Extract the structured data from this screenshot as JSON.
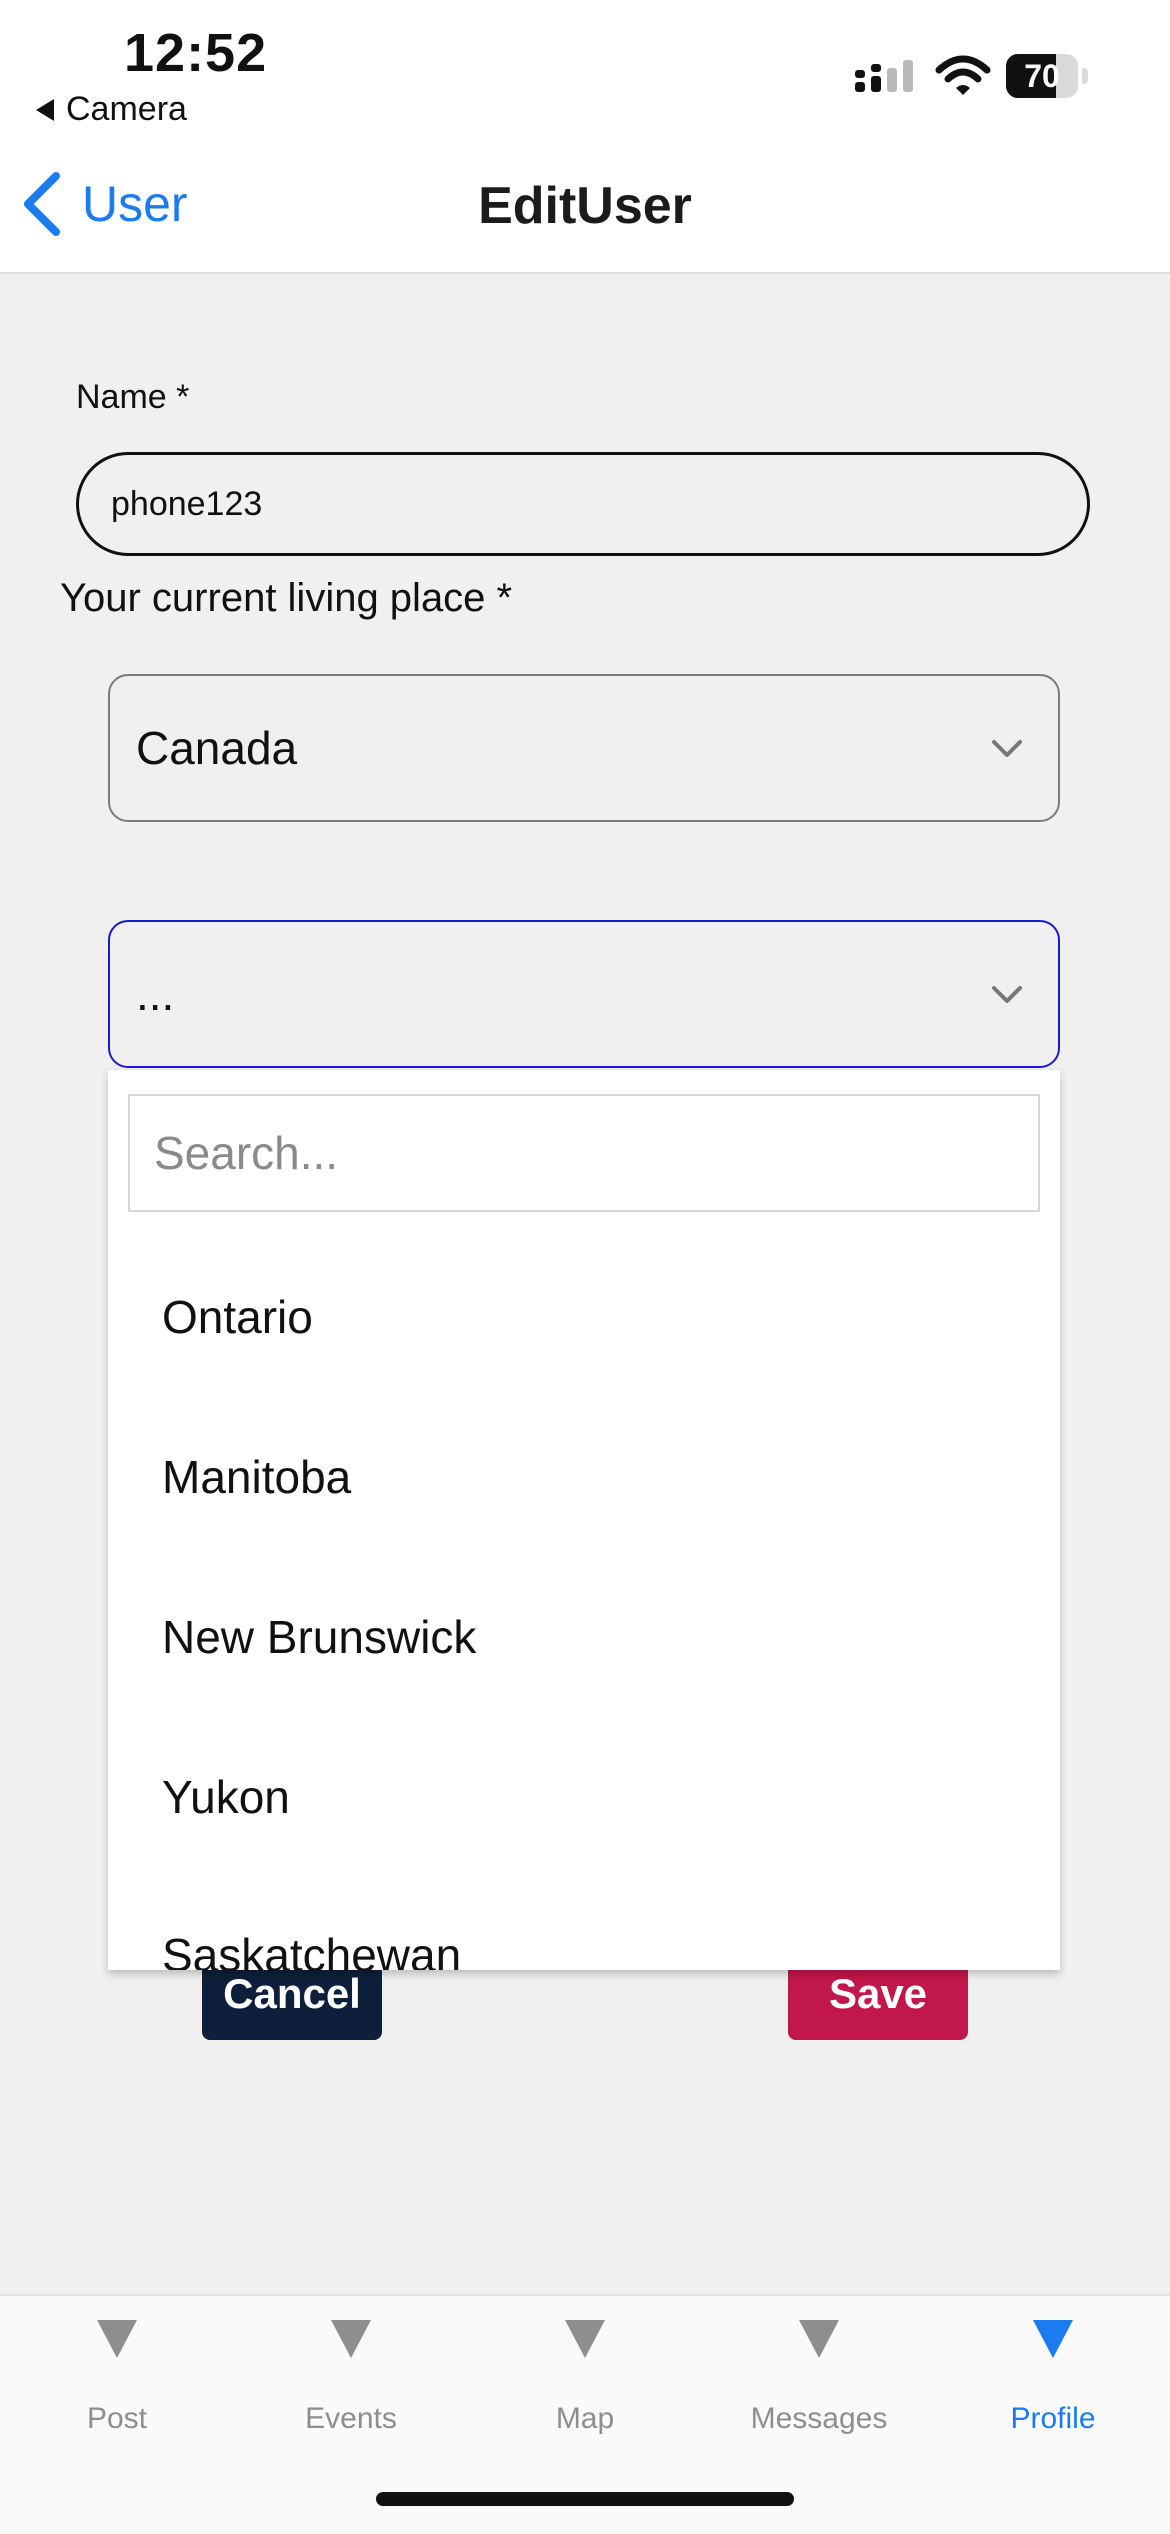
{
  "status_bar": {
    "time": "12:52",
    "back_app_label": "Camera",
    "battery_level": 70,
    "battery_text": "70"
  },
  "nav": {
    "back_label": "User",
    "title": "EditUser",
    "accent_color": "#1a7cf0"
  },
  "form": {
    "name_label": "Name *",
    "name_value": "phone123",
    "place_label": "Your current living place *",
    "country_value": "Canada",
    "region_value": "..."
  },
  "dropdown": {
    "search_placeholder": "Search...",
    "options": [
      "Ontario",
      "Manitoba",
      "New Brunswick",
      "Yukon",
      "Saskatchewan"
    ]
  },
  "buttons": {
    "cancel_label": "Cancel",
    "save_label": "Save",
    "cancel_color": "#0d1f3a",
    "save_color": "#c2174a"
  },
  "tabbar": {
    "active": "Profile",
    "tabs": [
      {
        "label": "Post",
        "icon": "triangle-down-icon"
      },
      {
        "label": "Events",
        "icon": "triangle-down-icon"
      },
      {
        "label": "Map",
        "icon": "triangle-down-icon"
      },
      {
        "label": "Messages",
        "icon": "triangle-down-icon"
      },
      {
        "label": "Profile",
        "icon": "triangle-down-icon"
      }
    ]
  }
}
